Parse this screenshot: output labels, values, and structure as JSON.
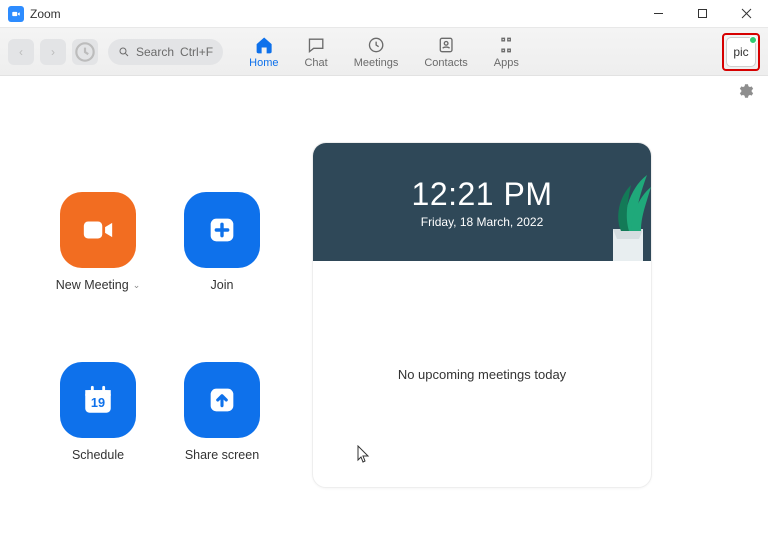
{
  "window": {
    "title": "Zoom"
  },
  "search": {
    "label": "Search",
    "shortcut": "Ctrl+F"
  },
  "tabs": {
    "home": "Home",
    "chat": "Chat",
    "meetings": "Meetings",
    "contacts": "Contacts",
    "apps": "Apps"
  },
  "avatar": {
    "label": "pic"
  },
  "actions": {
    "new_meeting": "New Meeting",
    "join": "Join",
    "schedule": "Schedule",
    "share_screen": "Share screen",
    "calendar_day": "19"
  },
  "panel": {
    "time": "12:21 PM",
    "date": "Friday, 18 March, 2022",
    "empty": "No upcoming meetings today"
  }
}
